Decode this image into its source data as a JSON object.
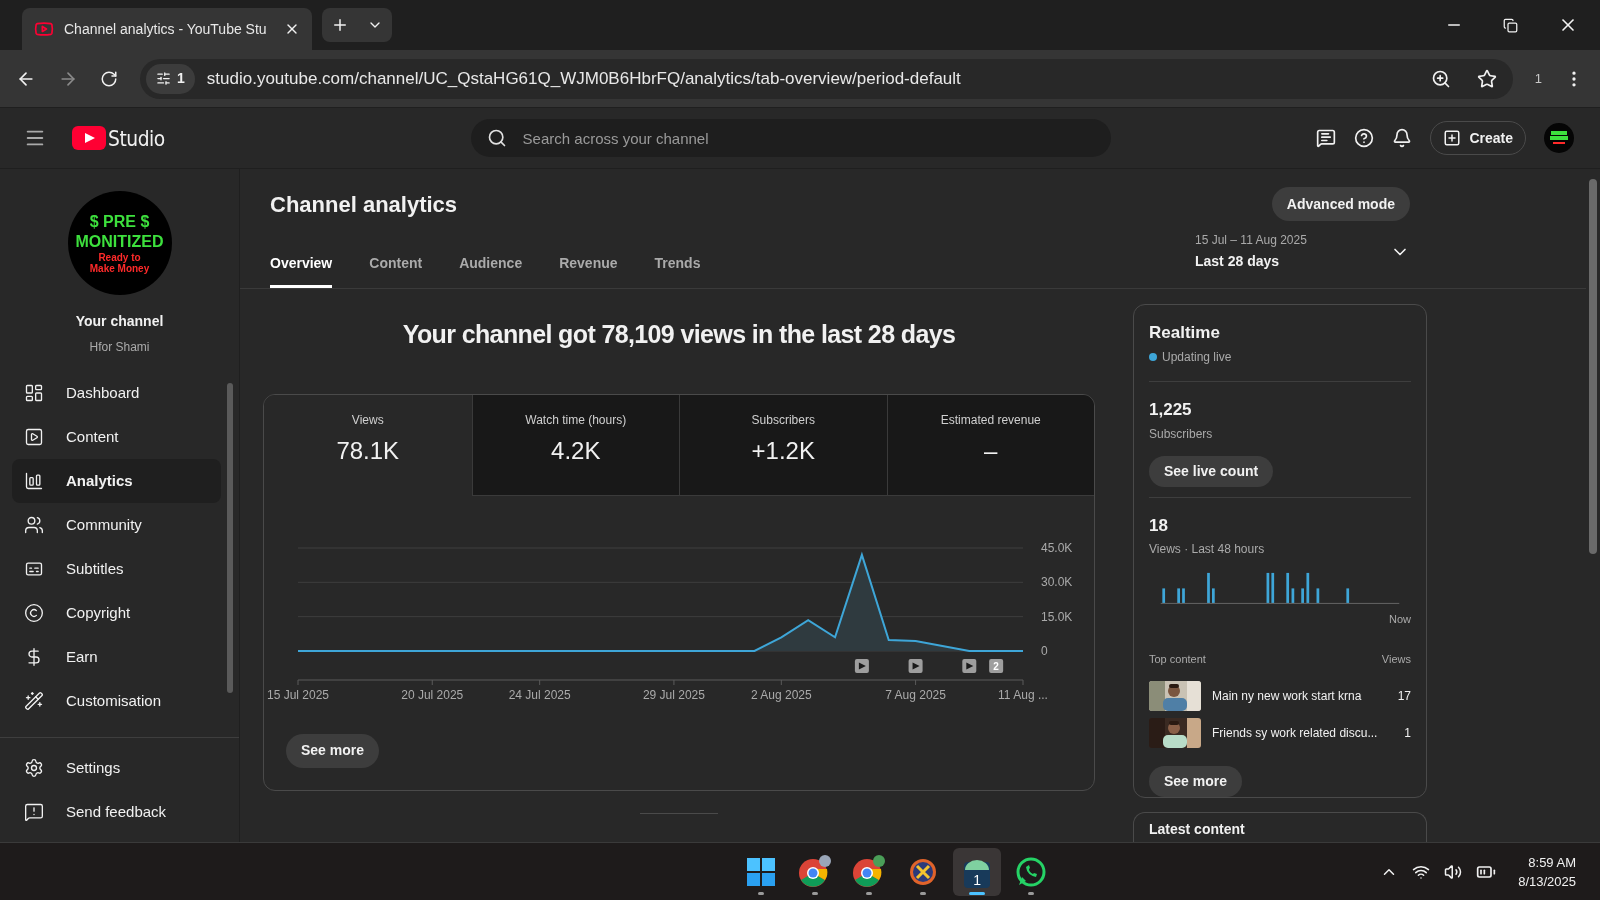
{
  "browser": {
    "tab_title": "Channel analytics - YouTube Stu",
    "url": "studio.youtube.com/channel/UC_QstaHG61Q_WJM0B6HbrFQ/analytics/tab-overview/period-default",
    "site_badge": "1",
    "extensions_count": "1"
  },
  "header": {
    "logo_text": "Studio",
    "search_placeholder": "Search across your channel",
    "create_label": "Create"
  },
  "channel": {
    "avatar_lines": [
      {
        "kind": "headline",
        "text": "$ PRE $"
      },
      {
        "kind": "headline",
        "text": "MONITIZED"
      },
      {
        "kind": "tagline",
        "text": "Ready to"
      },
      {
        "kind": "tagline",
        "text": "Make Money"
      }
    ],
    "title": "Your channel",
    "name": "Hfor Shami"
  },
  "nav": [
    {
      "label": "Dashboard",
      "selected": false
    },
    {
      "label": "Content",
      "selected": false
    },
    {
      "label": "Analytics",
      "selected": true
    },
    {
      "label": "Community",
      "selected": false
    },
    {
      "label": "Subtitles",
      "selected": false
    },
    {
      "label": "Copyright",
      "selected": false
    },
    {
      "label": "Earn",
      "selected": false
    },
    {
      "label": "Customisation",
      "selected": false
    }
  ],
  "nav_bottom": [
    {
      "label": "Settings"
    },
    {
      "label": "Send feedback"
    }
  ],
  "page": {
    "title": "Channel analytics",
    "advanced_button": "Advanced mode",
    "date_range": "15 Jul – 11 Aug 2025",
    "period": "Last 28 days"
  },
  "tabs": [
    {
      "label": "Overview",
      "selected": true
    },
    {
      "label": "Content",
      "selected": false
    },
    {
      "label": "Audience",
      "selected": false
    },
    {
      "label": "Revenue",
      "selected": false
    },
    {
      "label": "Trends",
      "selected": false
    }
  ],
  "headline": "Your channel got 78,109 views in the last 28 days",
  "metrics": [
    {
      "label": "Views",
      "value": "78.1K",
      "selected": true
    },
    {
      "label": "Watch time (hours)",
      "value": "4.2K",
      "selected": false
    },
    {
      "label": "Subscribers",
      "value": "+1.2K",
      "selected": false
    },
    {
      "label": "Estimated revenue",
      "value": "–",
      "selected": false
    }
  ],
  "chart_data": {
    "type": "area",
    "categories": [
      "15 Jul 2025",
      null,
      null,
      null,
      null,
      "20 Jul 2025",
      null,
      null,
      null,
      "24 Jul 2025",
      null,
      null,
      null,
      null,
      "29 Jul 2025",
      null,
      null,
      null,
      "2 Aug 2025",
      null,
      null,
      null,
      null,
      "7 Aug 2025",
      null,
      null,
      null,
      "11 Aug ..."
    ],
    "series": [
      {
        "color": "#3ea6d8",
        "values": [
          0,
          0,
          0,
          0,
          0,
          0,
          0,
          0,
          0,
          0,
          0,
          0,
          0,
          0,
          0,
          0,
          0,
          0,
          6000,
          13500,
          6000,
          42000,
          4800,
          4400,
          2200,
          0,
          0,
          0
        ]
      }
    ],
    "ylim": [
      0,
      45000
    ],
    "yticks": [
      {
        "value": 0,
        "label": "0"
      },
      {
        "value": 15000,
        "label": "15.0K"
      },
      {
        "value": 30000,
        "label": "30.0K"
      },
      {
        "value": 45000,
        "label": "45.0K"
      }
    ]
  },
  "video_markers": [
    {
      "kind": "video"
    },
    {
      "kind": "video"
    },
    {
      "kind": "video"
    },
    {
      "kind": "count",
      "text": "2"
    }
  ],
  "see_more": "See more",
  "realtime": {
    "title": "Realtime",
    "status": "Updating live",
    "subscribers": "1,225",
    "subscribers_label": "Subscribers",
    "live_count_button": "See live count",
    "views": "18",
    "views_label": "Views · Last 48 hours",
    "now_label": "Now",
    "top_content_label": "Top content",
    "views_column": "Views",
    "top_content": [
      {
        "title": "Main ny new work start krna",
        "views": "17"
      },
      {
        "title": "Friends sy work related discu...",
        "views": "1"
      }
    ],
    "see_more": "See more"
  },
  "latest_content": {
    "title": "Latest content"
  },
  "taskbar": {
    "apps": [
      {
        "kind": "windows",
        "selected": false
      },
      {
        "kind": "chrome",
        "selected": false
      },
      {
        "kind": "chrome",
        "selected": false
      },
      {
        "kind": "ix",
        "selected": false
      },
      {
        "kind": "badge-app",
        "selected": true,
        "badge": "1"
      },
      {
        "kind": "whatsapp",
        "selected": false
      }
    ],
    "time": "8:59 AM",
    "date": "8/13/2025"
  }
}
